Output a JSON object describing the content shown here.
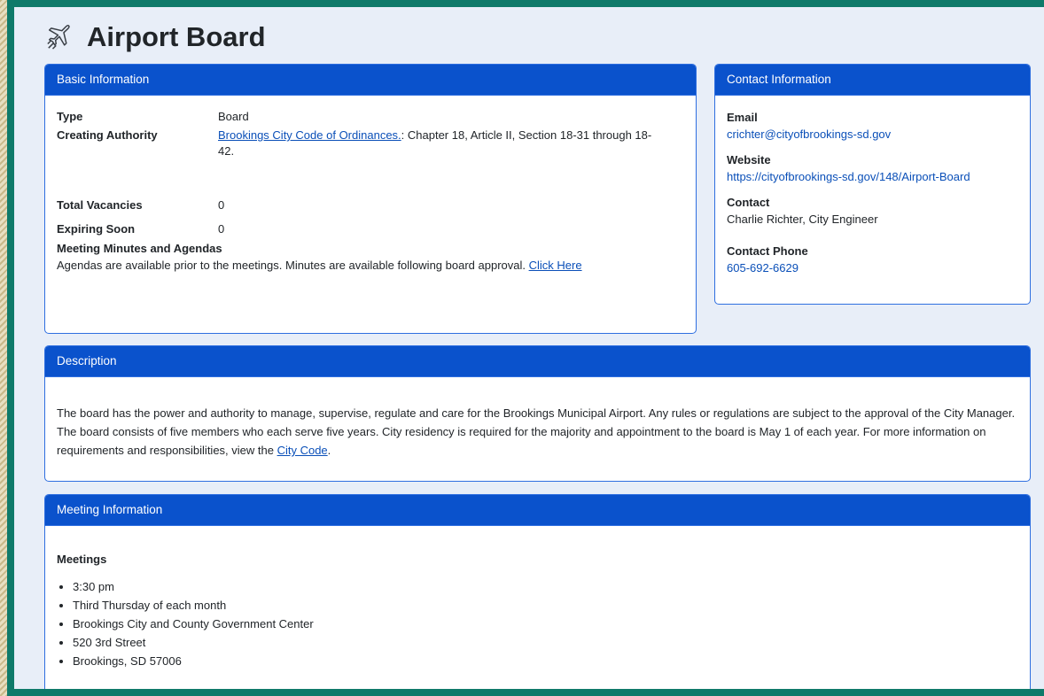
{
  "page": {
    "title": "Airport Board",
    "icon": "airplane-icon"
  },
  "basic_info": {
    "header": "Basic Information",
    "type_label": "Type",
    "type_value": "Board",
    "authority_label": "Creating Authority",
    "authority_link": "Brookings City Code of Ordinances.",
    "authority_text": ": Chapter 18, Article II, Section 18-31 through 18-42.",
    "vacancies_label": "Total Vacancies",
    "vacancies_value": "0",
    "expiring_label": "Expiring Soon",
    "expiring_value": "0",
    "minutes_label": "Meeting Minutes and Agendas",
    "minutes_text": "Agendas are available prior to the meetings. Minutes are available following board approval. ",
    "minutes_link": "Click Here"
  },
  "contact_info": {
    "header": "Contact Information",
    "email_label": "Email",
    "email_value": "crichter@cityofbrookings-sd.gov",
    "website_label": "Website",
    "website_value": "https://cityofbrookings-sd.gov/148/Airport-Board",
    "contact_label": "Contact",
    "contact_value": "Charlie Richter, City Engineer",
    "phone_label": "Contact Phone",
    "phone_value": "605-692-6629"
  },
  "description": {
    "header": "Description",
    "text": "The board has the power and authority to manage, supervise, regulate and care for the Brookings Municipal Airport. Any rules or regulations are subject to the approval of the City Manager. The board consists of five members who each serve five years. City residency is required for the majority and appointment to the board is May 1 of each year. For more information on requirements and responsibilities, view the ",
    "link": "City Code",
    "suffix": "."
  },
  "meeting_info": {
    "header": "Meeting Information",
    "meetings_label": "Meetings",
    "items": [
      "3:30 pm",
      "Third Thursday of each month",
      "Brookings City and County Government Center",
      "520 3rd Street",
      "Brookings, SD 57006"
    ]
  },
  "colors": {
    "header_bg": "#0a52cc",
    "card_border": "#2f6fe0",
    "page_bg": "#e8eef8",
    "frame": "#0f7a6a",
    "link": "#0a4fb8"
  }
}
